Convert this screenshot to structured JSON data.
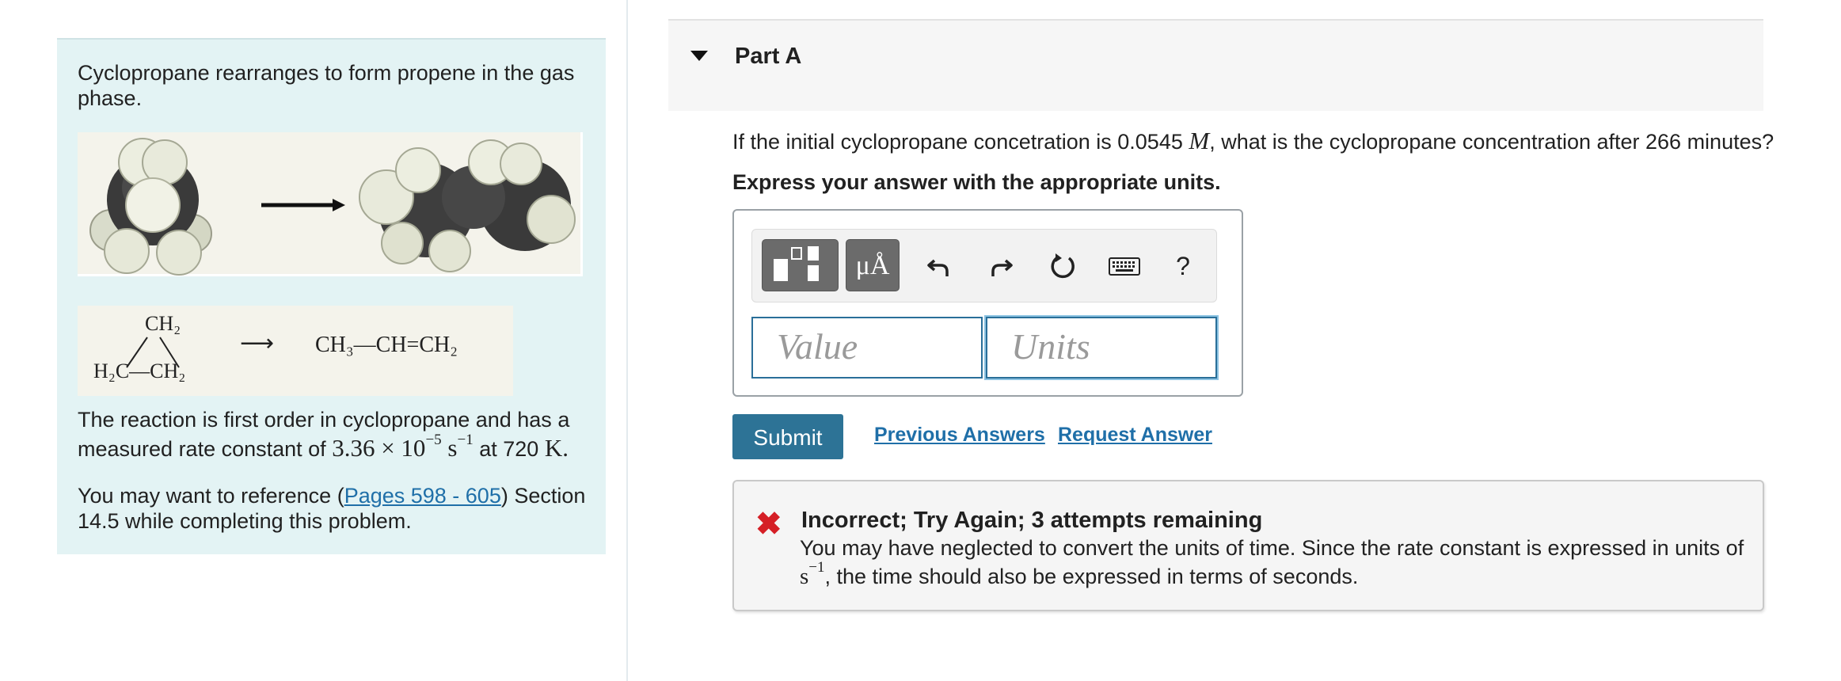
{
  "intro": {
    "para1": "Cyclopropane rearranges to form propene in the gas phase.",
    "structure": {
      "ring_top": "CH₂",
      "ring_bottom": "H₂C—CH₂",
      "arrow": "⟶",
      "product": "CH₃—CH=CH₂"
    },
    "para2_line1": "The reaction is first order in cyclopropane and has a",
    "para2_pre": "measured rate constant of",
    "rate_mantissa": "3.36 × 10",
    "rate_exp": "−5",
    "rate_unit": "s",
    "rate_unit_exp": "−1",
    "para2_mid": "at 720",
    "temp_unit": "K",
    "para3_pre": "You may want to reference (",
    "para3_link": "Pages 598 - 605",
    "para3_post": ") Section",
    "para3_line2": "14.5 while completing this problem."
  },
  "part": {
    "title": "Part A"
  },
  "question": {
    "pre": "If the initial cyclopropane concetration is 0.0545",
    "unit": "M",
    "post": ", what is the cyclopropane concentration after 266 minutes?",
    "instruction": "Express your answer with the appropriate units."
  },
  "toolbar": {
    "mu_angstrom": "μÅ",
    "help": "?"
  },
  "inputs": {
    "value_placeholder": "Value",
    "units_placeholder": "Units"
  },
  "actions": {
    "submit": "Submit",
    "previous_answers": "Previous Answers",
    "request_answer": "Request Answer"
  },
  "feedback": {
    "title": "Incorrect; Try Again; 3 attempts remaining",
    "line1": "You may have neglected to convert the units of time. Since the rate constant is expressed in units of",
    "unit_base": "s",
    "unit_exp": "−1",
    "line2_post": ", the time should also be expressed in terms of seconds."
  },
  "colors": {
    "intro_bg": "#e3f3f4",
    "submit_bg": "#2d7396",
    "link": "#1f6fa8",
    "error": "#d51f26"
  }
}
